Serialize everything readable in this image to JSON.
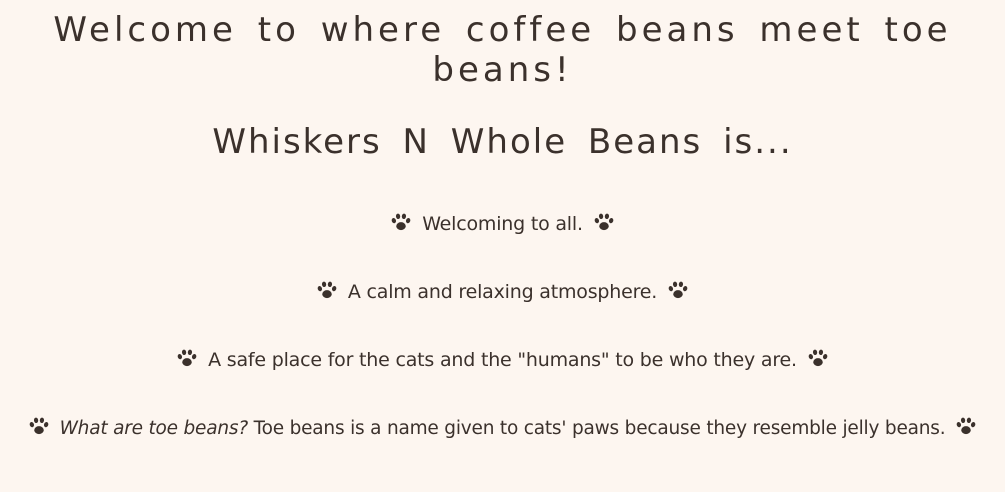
{
  "hero": {
    "title": "Welcome to where coffee beans meet toe beans!"
  },
  "about": {
    "heading": "Whiskers N Whole Beans is...",
    "features": [
      {
        "text": "Welcoming to all."
      },
      {
        "text": "A calm and relaxing atmosphere."
      },
      {
        "text": "A safe place for the cats and the \"humans\" to be who they are."
      },
      {
        "question": "What are toe beans?",
        "text": " Toe beans is a name given to cats' paws because they resemble jelly beans."
      }
    ],
    "icon": "paw-icon",
    "colors": {
      "background": "#fdf6f0",
      "text": "#3b312c"
    }
  }
}
